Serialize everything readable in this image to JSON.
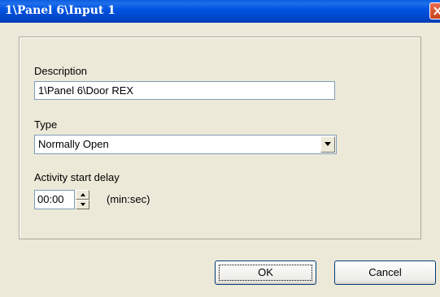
{
  "window": {
    "title": "1\\Panel 6\\Input 1",
    "close_icon": "close-icon"
  },
  "form": {
    "description_label": "Description",
    "description_value": "1\\Panel 6\\Door REX",
    "type_label": "Type",
    "type_value": "Normally Open",
    "delay_label": "Activity start delay",
    "delay_value": "00:00",
    "delay_unit": "(min:sec)"
  },
  "buttons": {
    "ok_label": "OK",
    "cancel_label": "Cancel"
  },
  "colors": {
    "titlebar": "#0054E3",
    "dialog_bg": "#ECE9D8",
    "close_button": "#D8542B"
  }
}
